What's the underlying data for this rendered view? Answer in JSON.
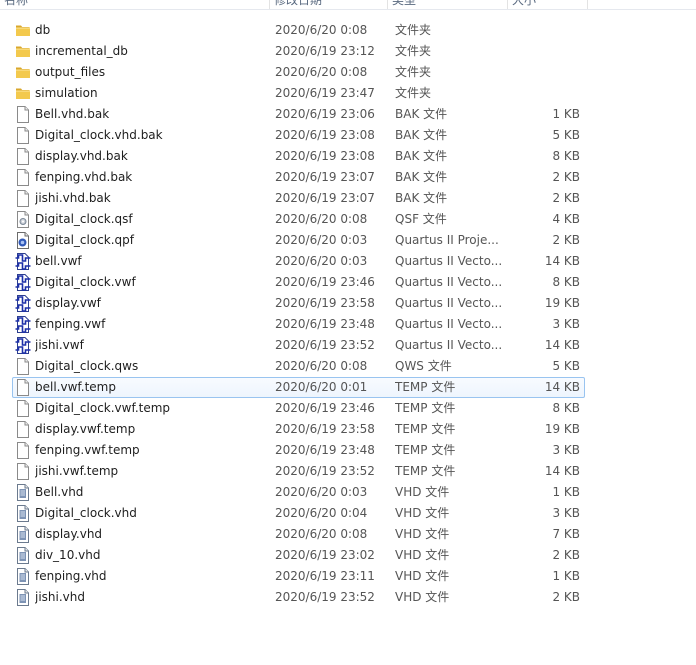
{
  "header": {
    "name": "名称",
    "date": "修改日期",
    "type": "类型",
    "size": "大小"
  },
  "files": [
    {
      "name": "db",
      "date": "2020/6/20 0:08",
      "type": "文件夹",
      "size": "",
      "icon": "folder-icon"
    },
    {
      "name": "incremental_db",
      "date": "2020/6/19 23:12",
      "type": "文件夹",
      "size": "",
      "icon": "folder-icon"
    },
    {
      "name": "output_files",
      "date": "2020/6/20 0:08",
      "type": "文件夹",
      "size": "",
      "icon": "folder-icon"
    },
    {
      "name": "simulation",
      "date": "2020/6/19 23:47",
      "type": "文件夹",
      "size": "",
      "icon": "folder-icon"
    },
    {
      "name": "Bell.vhd.bak",
      "date": "2020/6/19 23:06",
      "type": "BAK 文件",
      "size": "1 KB",
      "icon": "file-icon"
    },
    {
      "name": "Digital_clock.vhd.bak",
      "date": "2020/6/19 23:08",
      "type": "BAK 文件",
      "size": "5 KB",
      "icon": "file-icon"
    },
    {
      "name": "display.vhd.bak",
      "date": "2020/6/19 23:08",
      "type": "BAK 文件",
      "size": "8 KB",
      "icon": "file-icon"
    },
    {
      "name": "fenping.vhd.bak",
      "date": "2020/6/19 23:07",
      "type": "BAK 文件",
      "size": "2 KB",
      "icon": "file-icon"
    },
    {
      "name": "jishi.vhd.bak",
      "date": "2020/6/19 23:07",
      "type": "BAK 文件",
      "size": "2 KB",
      "icon": "file-icon"
    },
    {
      "name": "Digital_clock.qsf",
      "date": "2020/6/20 0:08",
      "type": "QSF 文件",
      "size": "4 KB",
      "icon": "settings-file-icon"
    },
    {
      "name": "Digital_clock.qpf",
      "date": "2020/6/20 0:03",
      "type": "Quartus II Proje...",
      "size": "2 KB",
      "icon": "quartus-project-icon"
    },
    {
      "name": "bell.vwf",
      "date": "2020/6/20 0:03",
      "type": "Quartus II Vecto...",
      "size": "14 KB",
      "icon": "waveform-icon"
    },
    {
      "name": "Digital_clock.vwf",
      "date": "2020/6/19 23:46",
      "type": "Quartus II Vecto...",
      "size": "8 KB",
      "icon": "waveform-icon"
    },
    {
      "name": "display.vwf",
      "date": "2020/6/19 23:58",
      "type": "Quartus II Vecto...",
      "size": "19 KB",
      "icon": "waveform-icon"
    },
    {
      "name": "fenping.vwf",
      "date": "2020/6/19 23:48",
      "type": "Quartus II Vecto...",
      "size": "3 KB",
      "icon": "waveform-icon"
    },
    {
      "name": "jishi.vwf",
      "date": "2020/6/19 23:52",
      "type": "Quartus II Vecto...",
      "size": "14 KB",
      "icon": "waveform-icon"
    },
    {
      "name": "Digital_clock.qws",
      "date": "2020/6/20 0:08",
      "type": "QWS 文件",
      "size": "5 KB",
      "icon": "file-icon"
    },
    {
      "name": "bell.vwf.temp",
      "date": "2020/6/20 0:01",
      "type": "TEMP 文件",
      "size": "14 KB",
      "icon": "file-icon",
      "selected": true
    },
    {
      "name": "Digital_clock.vwf.temp",
      "date": "2020/6/19 23:46",
      "type": "TEMP 文件",
      "size": "8 KB",
      "icon": "file-icon"
    },
    {
      "name": "display.vwf.temp",
      "date": "2020/6/19 23:58",
      "type": "TEMP 文件",
      "size": "19 KB",
      "icon": "file-icon"
    },
    {
      "name": "fenping.vwf.temp",
      "date": "2020/6/19 23:48",
      "type": "TEMP 文件",
      "size": "3 KB",
      "icon": "file-icon"
    },
    {
      "name": "jishi.vwf.temp",
      "date": "2020/6/19 23:52",
      "type": "TEMP 文件",
      "size": "14 KB",
      "icon": "file-icon"
    },
    {
      "name": "Bell.vhd",
      "date": "2020/6/20 0:03",
      "type": "VHD 文件",
      "size": "1 KB",
      "icon": "vhdl-file-icon"
    },
    {
      "name": "Digital_clock.vhd",
      "date": "2020/6/20 0:04",
      "type": "VHD 文件",
      "size": "3 KB",
      "icon": "vhdl-file-icon"
    },
    {
      "name": "display.vhd",
      "date": "2020/6/20 0:08",
      "type": "VHD 文件",
      "size": "7 KB",
      "icon": "vhdl-file-icon"
    },
    {
      "name": "div_10.vhd",
      "date": "2020/6/19 23:02",
      "type": "VHD 文件",
      "size": "2 KB",
      "icon": "vhdl-file-icon"
    },
    {
      "name": "fenping.vhd",
      "date": "2020/6/19 23:11",
      "type": "VHD 文件",
      "size": "1 KB",
      "icon": "vhdl-file-icon"
    },
    {
      "name": "jishi.vhd",
      "date": "2020/6/19 23:52",
      "type": "VHD 文件",
      "size": "2 KB",
      "icon": "vhdl-file-icon"
    }
  ]
}
